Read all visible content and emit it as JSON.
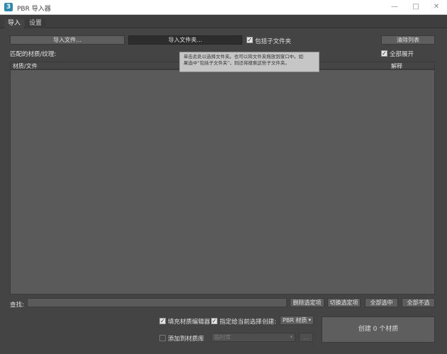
{
  "window": {
    "title": "PBR 导入器",
    "minimize": "—",
    "maximize": "□",
    "close": "✕"
  },
  "tabs": [
    {
      "label": "导入"
    },
    {
      "label": "设置"
    }
  ],
  "toolbar": {
    "import_files": "导入文件...",
    "import_folder": "导入文件夹...",
    "include_subfolders": "包括子文件夹",
    "clear_list": "清除列表",
    "expand_all": "全部展开"
  },
  "matched_label": "匹配的材质/纹理:",
  "list": {
    "col_material": "材质/文件",
    "col_note": "解释"
  },
  "tooltip": {
    "line1": "单击此处以选择文件夹。也可以将文件夹拖放到窗口中。如",
    "line2": "果选中“包括子文件夹”，则还将搜索这些子文件夹。"
  },
  "search": {
    "label": "查找:",
    "value": ""
  },
  "selection_buttons": {
    "delete_selected": "删除选定项",
    "toggle_selected": "切换选定项",
    "select_all": "全部选中",
    "select_none": "全部不选"
  },
  "options": {
    "fill_editor": "填充材质编辑器",
    "assign_selection": "指定给当前选择",
    "create_label": "创建:",
    "create_type": "PBR 材质",
    "add_library": "添加到材质库",
    "library_value": "临时库",
    "browse": "..."
  },
  "create_button": "创建 0 个材质"
}
